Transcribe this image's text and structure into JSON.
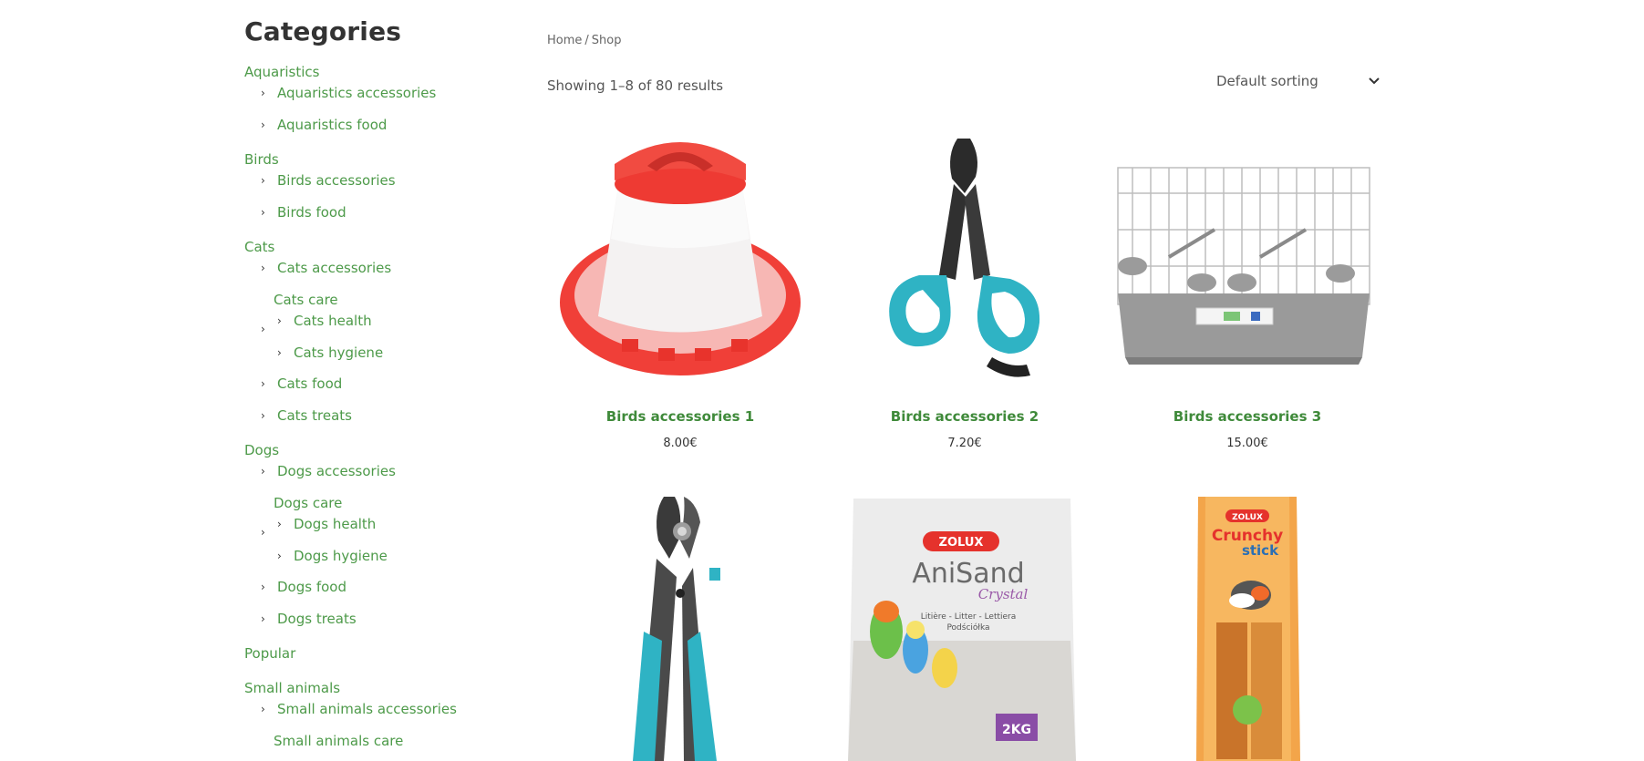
{
  "sidebar": {
    "title": "Categories",
    "chevron": "›",
    "items": [
      {
        "label": "Aquaristics"
      },
      {
        "label": "Aquaristics accessories"
      },
      {
        "label": "Aquaristics food"
      },
      {
        "label": "Birds"
      },
      {
        "label": "Birds accessories"
      },
      {
        "label": "Birds food"
      },
      {
        "label": "Cats"
      },
      {
        "label": "Cats accessories"
      },
      {
        "label": "Cats care"
      },
      {
        "label": "Cats health"
      },
      {
        "label": "Cats hygiene"
      },
      {
        "label": "Cats food"
      },
      {
        "label": "Cats treats"
      },
      {
        "label": "Dogs"
      },
      {
        "label": "Dogs accessories"
      },
      {
        "label": "Dogs care"
      },
      {
        "label": "Dogs health"
      },
      {
        "label": "Dogs hygiene"
      },
      {
        "label": "Dogs food"
      },
      {
        "label": "Dogs treats"
      },
      {
        "label": "Popular"
      },
      {
        "label": "Small animals"
      },
      {
        "label": "Small animals accessories"
      },
      {
        "label": "Small animals care"
      }
    ]
  },
  "breadcrumb": {
    "home": "Home",
    "separator": "/",
    "current": "Shop"
  },
  "result_count": "Showing 1–8 of 80 results",
  "sorting": {
    "selected": "Default sorting",
    "icon": "chevron-down-icon"
  },
  "products": [
    {
      "name": "Birds accessories 1",
      "price": "8.00€"
    },
    {
      "name": "Birds accessories 2",
      "price": "7.20€"
    },
    {
      "name": "Birds accessories 3",
      "price": "15.00€"
    }
  ],
  "product_images_row2": {
    "zolux_brand": "ZOLUX",
    "anisand_title": "AniSand",
    "anisand_sub": "Crystal",
    "anisand_litter": "Litière - Litter - Lettiera",
    "anisand_pl": "Podściółka",
    "anisand_weight": "2KG",
    "crunchy_title_1": "Crunchy",
    "crunchy_title_2": "stick"
  },
  "colors": {
    "category_link": "#4d9a49",
    "product_title": "#3f8a3a",
    "text": "#333333"
  }
}
